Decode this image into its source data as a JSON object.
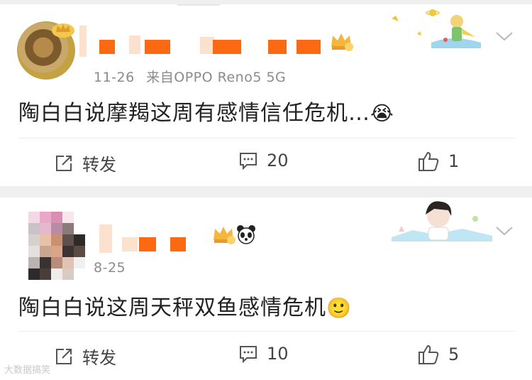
{
  "posts": [
    {
      "date": "11-26",
      "source": "来自OPPO Reno5 5G",
      "text": "陶白白说摩羯这周有感情信任危机…",
      "emoji": "😭",
      "actions": {
        "repost": "转发",
        "comment_count": "20",
        "like_count": "1"
      }
    },
    {
      "date": "8-25",
      "source": "",
      "text": "陶白白说这周天秤双鱼感情危机",
      "emoji": "🙂",
      "actions": {
        "repost": "转发",
        "comment_count": "10",
        "like_count": "5"
      }
    }
  ],
  "watermark": "大数据搞笑"
}
